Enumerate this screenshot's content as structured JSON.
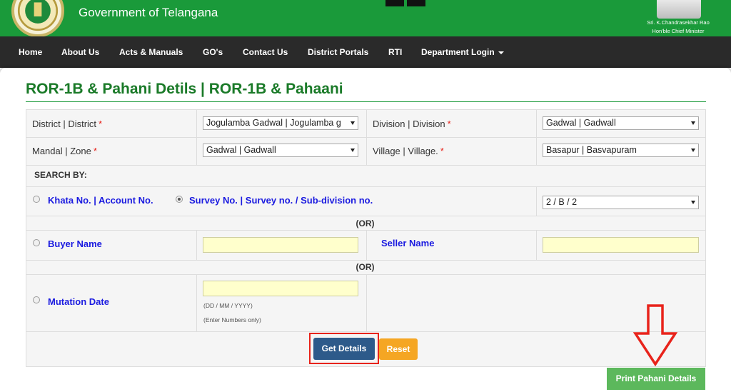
{
  "header": {
    "title": "Government of Telangana",
    "cm_name": "Sri. K.Chandrasekhar Rao",
    "cm_title": "Hon'ble Chief Minister",
    "brand_color": "#1a9a3a"
  },
  "nav": {
    "items": [
      "Home",
      "About Us",
      "Acts & Manuals",
      "GO's",
      "Contact Us",
      "District Portals",
      "RTI",
      "Department Login"
    ]
  },
  "page": {
    "title": "ROR-1B & Pahani Detils | ROR-1B & Pahaani"
  },
  "form": {
    "district_label": "District | District",
    "district_value": "Jogulamba Gadwal | Jogulamba g",
    "division_label": "Division | Division",
    "division_value": "Gadwal | Gadwall",
    "mandal_label": "Mandal | Zone",
    "mandal_value": "Gadwal | Gadwall",
    "village_label": "Village | Village.",
    "village_value": "Basapur | Basvapuram",
    "required_mark": "*",
    "search_by": "SEARCH BY:",
    "khata_label": "Khata No. | Account No.",
    "survey_label": "Survey No. | Survey no. / Sub-division no.",
    "survey_value": "2 / B / 2",
    "or_text": "(OR)",
    "buyer_label": "Buyer Name",
    "seller_label": "Seller Name",
    "mutation_label": "Mutation Date",
    "date_hint": "(DD / MM / YYYY)",
    "numbers_hint": "(Enter Numbers only)"
  },
  "buttons": {
    "get_details": "Get Details",
    "reset": "Reset",
    "print_pahani": "Print Pahani Details"
  },
  "colors": {
    "title_green": "#1a7a28",
    "annotation_red": "#e8231b",
    "print_green": "#5cb85c",
    "reset_orange": "#f5a623",
    "get_blue": "#2d5a8a"
  }
}
